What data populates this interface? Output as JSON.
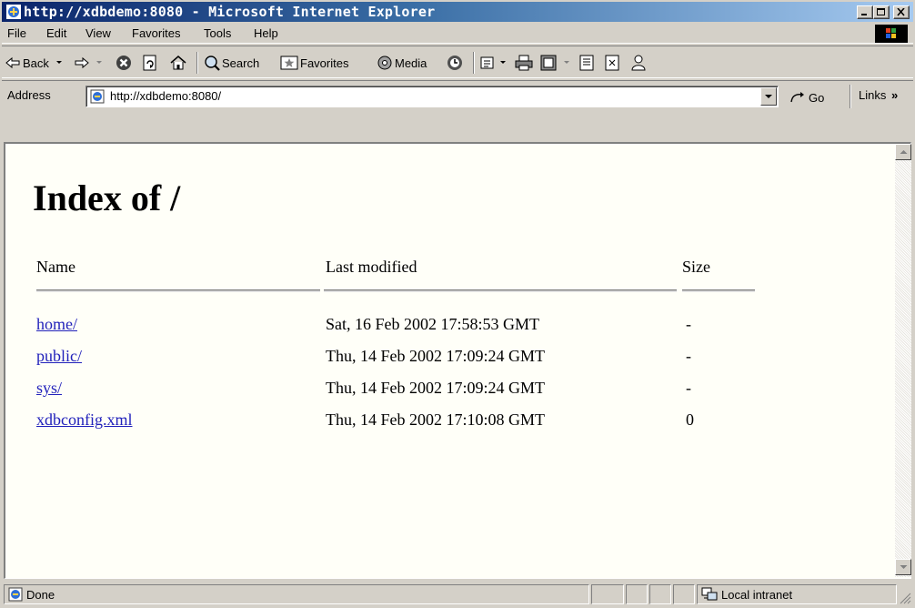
{
  "window": {
    "title": "http://xdbdemo:8080 - Microsoft Internet Explorer"
  },
  "menu": [
    "File",
    "Edit",
    "View",
    "Favorites",
    "Tools",
    "Help"
  ],
  "toolbar": {
    "back_label": "Back",
    "search_label": "Search",
    "favorites_label": "Favorites",
    "media_label": "Media"
  },
  "address": {
    "label": "Address",
    "url": "http://xdbdemo:8080/",
    "go_label": "Go",
    "links_label": "Links"
  },
  "page": {
    "heading": "Index of /",
    "columns": [
      "Name",
      "Last modified",
      "Size"
    ],
    "rows": [
      {
        "name": "home/",
        "modified": "Sat, 16 Feb 2002 17:58:53 GMT",
        "size": "-"
      },
      {
        "name": "public/",
        "modified": "Thu, 14 Feb 2002 17:09:24 GMT",
        "size": "-"
      },
      {
        "name": "sys/",
        "modified": "Thu, 14 Feb 2002 17:09:24 GMT",
        "size": "-"
      },
      {
        "name": "xdbconfig.xml",
        "modified": "Thu, 14 Feb 2002 17:10:08 GMT",
        "size": "0"
      }
    ]
  },
  "status": {
    "text": "Done",
    "zone": "Local intranet"
  },
  "colors": {
    "title_gradient_start": "#0a246a",
    "title_gradient_end": "#a6caf0",
    "chrome": "#d4d0c8",
    "page_bg": "#fffff8",
    "link": "#2222bb"
  }
}
